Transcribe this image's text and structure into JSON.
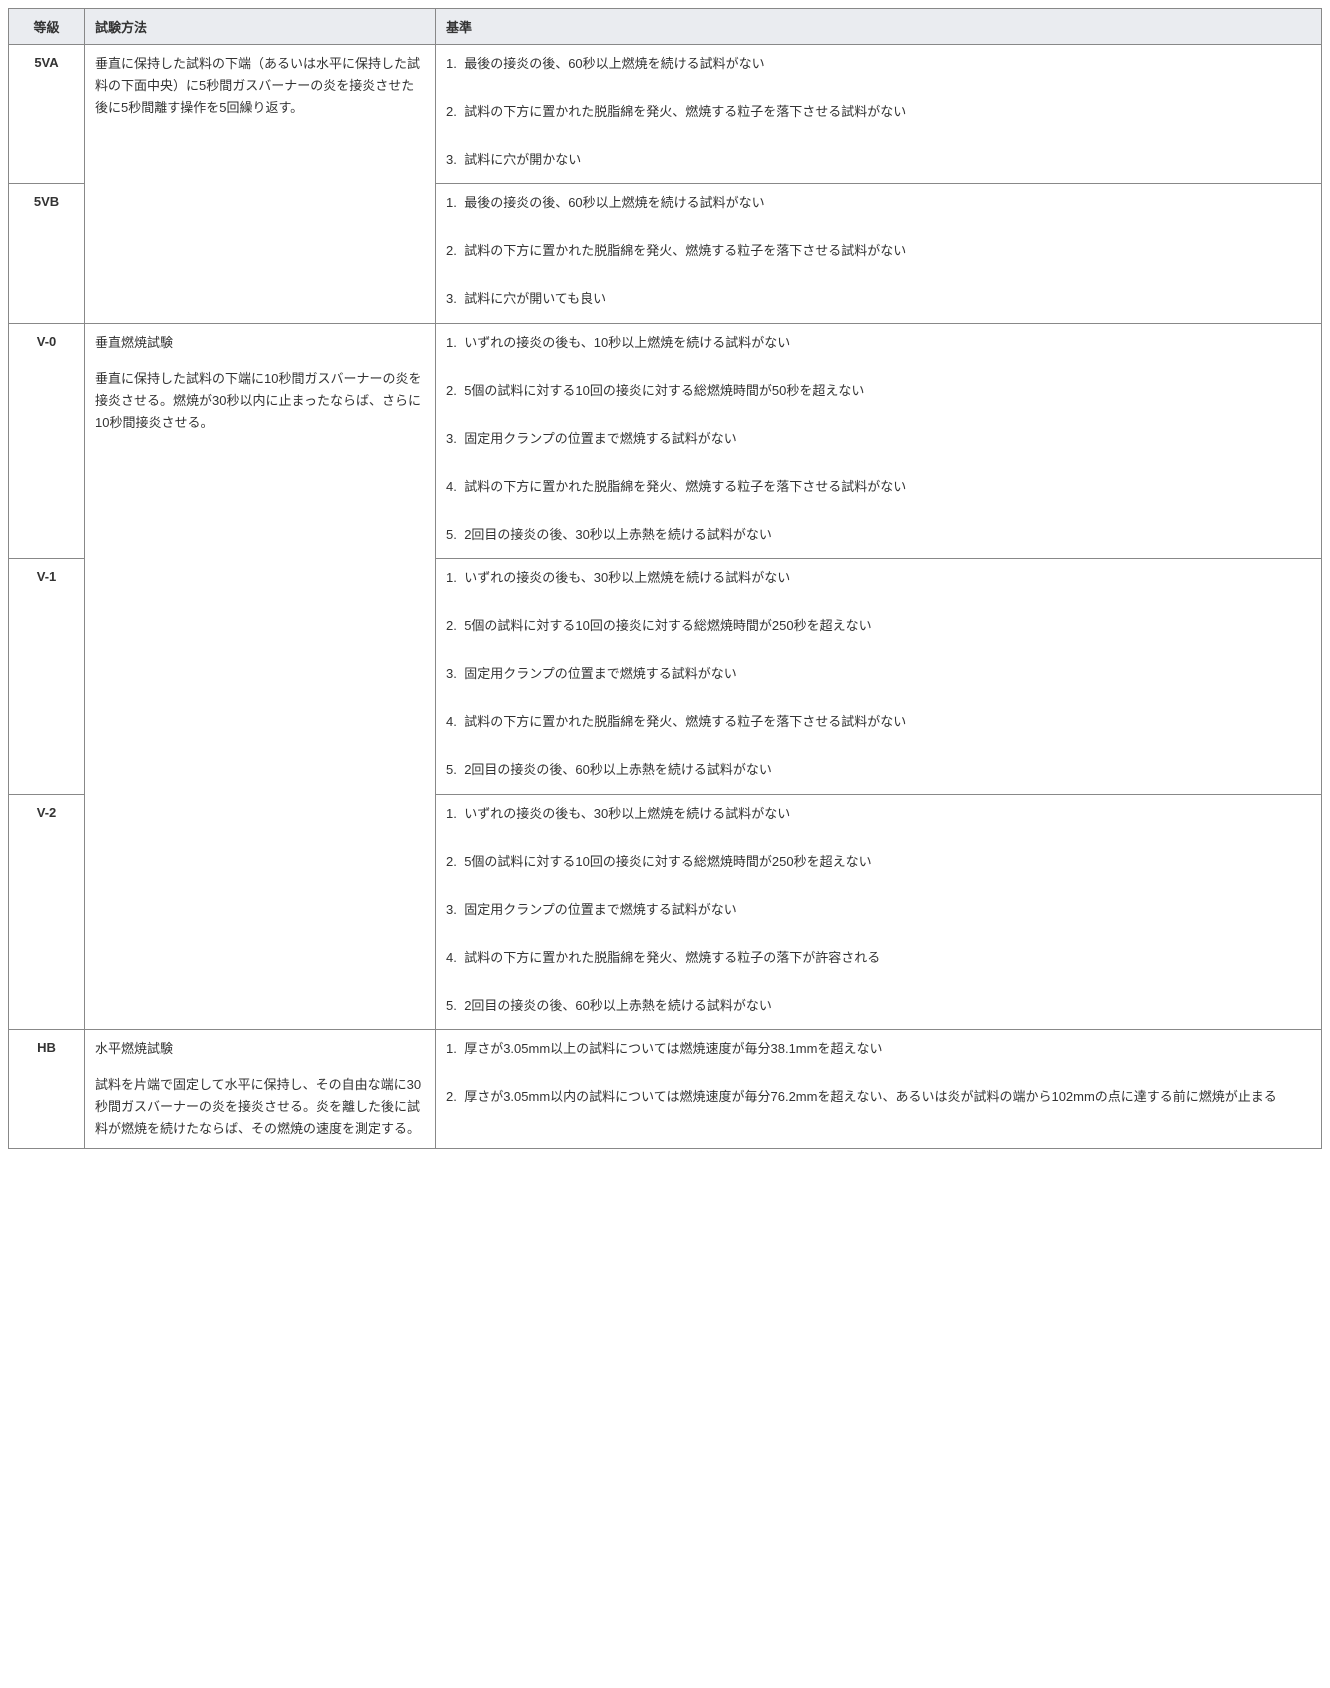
{
  "headers": {
    "grade": "等級",
    "method": "試験方法",
    "criteria": "基準"
  },
  "groups": [
    {
      "method_title": "",
      "method_desc": "垂直に保持した試料の下端（あるいは水平に保持した試料の下面中央）に5秒間ガスバーナーの炎を接炎させた後に5秒間離す操作を5回繰り返す。",
      "rows": [
        {
          "grade": "5VA",
          "criteria": [
            "最後の接炎の後、60秒以上燃焼を続ける試料がない",
            "試料の下方に置かれた脱脂綿を発火、燃焼する粒子を落下させる試料がない",
            "試料に穴が開かない"
          ]
        },
        {
          "grade": "5VB",
          "criteria": [
            "最後の接炎の後、60秒以上燃焼を続ける試料がない",
            "試料の下方に置かれた脱脂綿を発火、燃焼する粒子を落下させる試料がない",
            "試料に穴が開いても良い"
          ]
        }
      ]
    },
    {
      "method_title": "垂直燃焼試験",
      "method_desc": "垂直に保持した試料の下端に10秒間ガスバーナーの炎を接炎させる。燃焼が30秒以内に止まったならば、さらに10秒間接炎させる。",
      "rows": [
        {
          "grade": "V-0",
          "criteria": [
            "いずれの接炎の後も、10秒以上燃焼を続ける試料がない",
            "5個の試料に対する10回の接炎に対する総燃焼時間が50秒を超えない",
            "固定用クランプの位置まで燃焼する試料がない",
            "試料の下方に置かれた脱脂綿を発火、燃焼する粒子を落下させる試料がない",
            "2回目の接炎の後、30秒以上赤熱を続ける試料がない"
          ]
        },
        {
          "grade": "V-1",
          "criteria": [
            "いずれの接炎の後も、30秒以上燃焼を続ける試料がない",
            "5個の試料に対する10回の接炎に対する総燃焼時間が250秒を超えない",
            "固定用クランプの位置まで燃焼する試料がない",
            "試料の下方に置かれた脱脂綿を発火、燃焼する粒子を落下させる試料がない",
            "2回目の接炎の後、60秒以上赤熱を続ける試料がない"
          ]
        },
        {
          "grade": "V-2",
          "criteria": [
            "いずれの接炎の後も、30秒以上燃焼を続ける試料がない",
            "5個の試料に対する10回の接炎に対する総燃焼時間が250秒を超えない",
            "固定用クランプの位置まで燃焼する試料がない",
            "試料の下方に置かれた脱脂綿を発火、燃焼する粒子の落下が許容される",
            "2回目の接炎の後、60秒以上赤熱を続ける試料がない"
          ]
        }
      ]
    },
    {
      "method_title": "水平燃焼試験",
      "method_desc": "試料を片端で固定して水平に保持し、その自由な端に30秒間ガスバーナーの炎を接炎させる。炎を離した後に試料が燃焼を続けたならば、その燃焼の速度を測定する。",
      "rows": [
        {
          "grade": "HB",
          "criteria": [
            "厚さが3.05mm以上の試料については燃焼速度が毎分38.1mmを超えない",
            "厚さが3.05mm以内の試料については燃焼速度が毎分76.2mmを超えない、あるいは炎が試料の端から102mmの点に達する前に燃焼が止まる"
          ]
        }
      ]
    }
  ]
}
